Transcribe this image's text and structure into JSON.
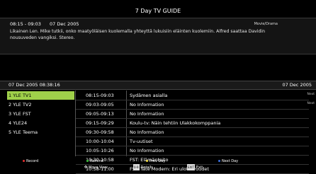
{
  "title": "7 Day TV GUIDE",
  "info": {
    "time": "08:15 - 09:03",
    "date": "07 Dec 2005",
    "genre": "Movie/Drama",
    "description": "Likainen Len. Mike tutkii, onko maatyöläisen kuolemalla yhteyttä lukuisiin eläinten kuolemiin. Alfred saattaa Davidin nousuveden vangiksi. Stereo."
  },
  "datebar": {
    "now": "07 Dec 2005 08:38:16",
    "day": "07 Dec 2005"
  },
  "side_labels": {
    "first": "Next",
    "second": "Next"
  },
  "channels": [
    "1 YLE TV1",
    "2 YLE TV2",
    "3 YLE FST",
    "4 YLE24",
    "5 YLE Teema"
  ],
  "programs": [
    {
      "time": "08:15-09:03",
      "name": "Sydämen asialla"
    },
    {
      "time": "09:03-09:05",
      "name": "No Information"
    },
    {
      "time": "09:05-09:13",
      "name": "No Information"
    },
    {
      "time": "09:15-09:29",
      "name": "Koulu-tv: Näin tehtiin Ulakkokomppania"
    },
    {
      "time": "09:30-09:58",
      "name": "No Information"
    },
    {
      "time": "10:00-10:04",
      "name": "Tv-uutiset"
    },
    {
      "time": "10:05-10:26",
      "name": "No Information"
    },
    {
      "time": "10:30-10:58",
      "name": "FST: Elämäntaito"
    },
    {
      "time": "10:58-11:00",
      "name": "FST: Tate Modern: Eri ulottuvuudet"
    }
  ],
  "footer": {
    "record": "Record",
    "remind": "Remind",
    "prev_day": "Prev Day",
    "next_day": "Next Day",
    "move_view": "Move View",
    "details": "Details",
    "details_key": "0-9",
    "exit": "Exit",
    "exit_key": "EXIT"
  },
  "colors": {
    "selected": "#9fd04a",
    "red": "#e53030",
    "green": "#3bbf3b",
    "yellow": "#e8d23a",
    "blue": "#3a6fe0"
  }
}
